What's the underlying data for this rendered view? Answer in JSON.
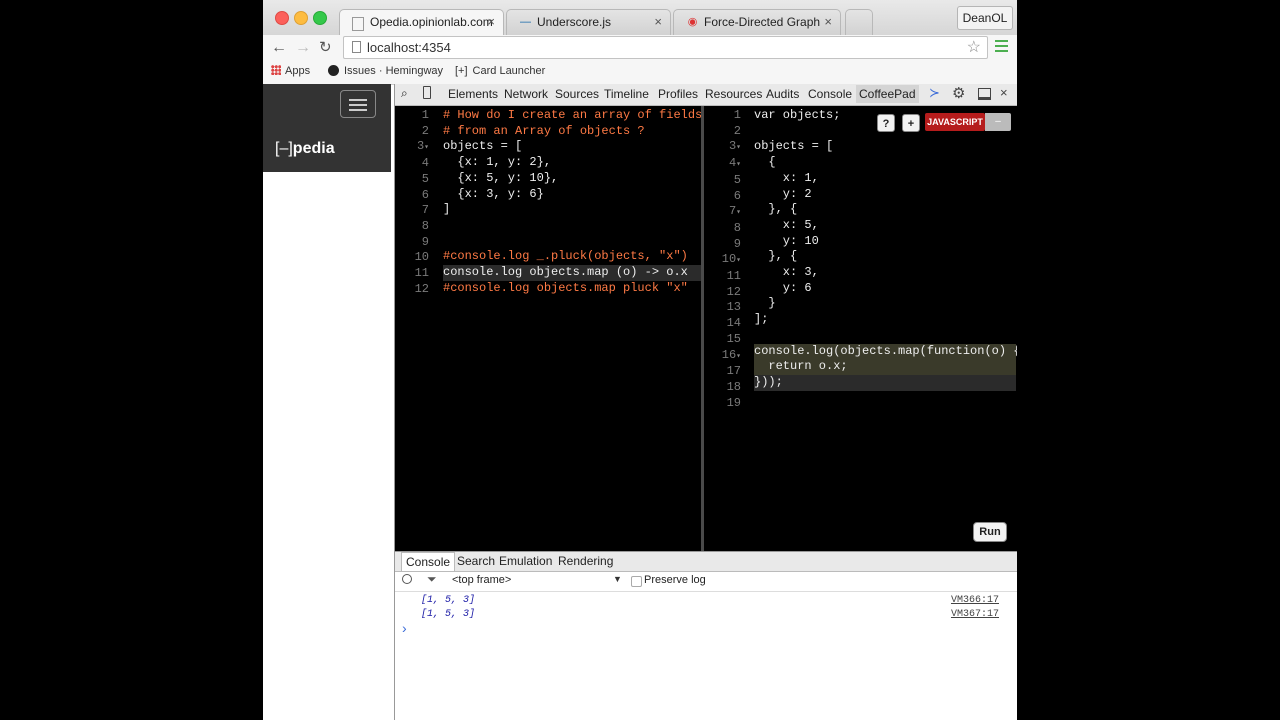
{
  "browser": {
    "tabs": [
      {
        "label": "Opedia.opinionlab.com",
        "active": true
      },
      {
        "label": "Underscore.js",
        "active": false
      },
      {
        "label": "Force-Directed Graph",
        "active": false
      }
    ],
    "profile": "DeanOL",
    "url": "localhost:4354",
    "bookmarks": [
      "Apps",
      "Issues · Hemingway",
      "Card Launcher"
    ]
  },
  "site": {
    "logo_bracket": "[–]",
    "logo_text": "pedia"
  },
  "devtools": {
    "tabs": [
      "Elements",
      "Network",
      "Sources",
      "Timeline",
      "Profiles",
      "Resources",
      "Audits",
      "Console",
      "CoffeePad"
    ],
    "selected_tab": "CoffeePad"
  },
  "coffee_editor": {
    "lines": [
      "# How do I create an array of fields",
      "# from an Array of objects ?",
      "objects = [",
      "  {x: 1, y: 2},",
      "  {x: 5, y: 10},",
      "  {x: 3, y: 6}",
      "]",
      "",
      "",
      "#console.log _.pluck(objects, \"x\")",
      "console.log objects.map (o) -> o.x",
      "#console.log objects.map pluck \"x\""
    ]
  },
  "js_output": {
    "lines": [
      "var objects;",
      "",
      "objects = [",
      "  {",
      "    x: 1,",
      "    y: 2",
      "  }, {",
      "    x: 5,",
      "    y: 10",
      "  }, {",
      "    x: 3,",
      "    y: 6",
      "  }",
      "];",
      "",
      "console.log(objects.map(function(o) {",
      "  return o.x;",
      "}));",
      ""
    ],
    "help_label": "?",
    "plus_label": "+",
    "lang_label": "JAVASCRIPT",
    "minus_label": "–"
  },
  "run_label": "Run",
  "console": {
    "tabs": [
      "Console",
      "Search",
      "Emulation",
      "Rendering"
    ],
    "frame": "<top frame>",
    "preserve_log": "Preserve log",
    "logs": [
      {
        "text": "[1, 5, 3]",
        "source": "VM366:17"
      },
      {
        "text": "[1, 5, 3]",
        "source": "VM367:17"
      }
    ],
    "prompt": "›"
  },
  "colors": {
    "accent_js": "#b51c1c",
    "comment": "#ff7a45",
    "number": "#e98ee6"
  }
}
